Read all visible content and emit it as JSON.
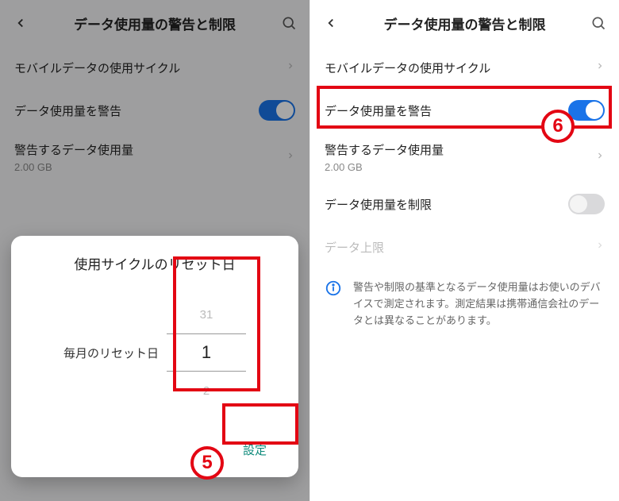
{
  "left": {
    "header_title": "データ使用量の警告と制限",
    "rows": {
      "cycle_label": "モバイルデータの使用サイクル",
      "warn_label": "データ使用量を警告",
      "threshold_label": "警告するデータ使用量",
      "threshold_value": "2.00 GB"
    },
    "dialog": {
      "title": "使用サイクルのリセット日",
      "body_label": "毎月のリセット日",
      "picker_prev": "31",
      "picker_current": "1",
      "picker_next": "2",
      "confirm": "設定"
    },
    "annotation_number": "5"
  },
  "right": {
    "header_title": "データ使用量の警告と制限",
    "rows": {
      "cycle_label": "モバイルデータの使用サイクル",
      "warn_label": "データ使用量を警告",
      "threshold_label": "警告するデータ使用量",
      "threshold_value": "2.00 GB",
      "limit_label": "データ使用量を制限",
      "cap_label": "データ上限"
    },
    "info_text": "警告や制限の基準となるデータ使用量はお使いのデバイスで測定されます。測定結果は携帯通信会社のデータとは異なることがあります。",
    "annotation_number": "6"
  }
}
